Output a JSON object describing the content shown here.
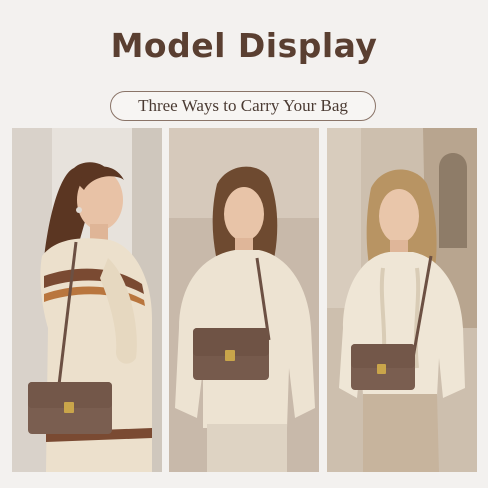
{
  "page": {
    "title": "Model Display",
    "subtitle": "Three Ways to Carry Your Bag"
  },
  "panels": [
    {
      "id": "model-1",
      "pose": "side view, bag on shoulder",
      "sweater": "striped cream knit",
      "bag_color": "#7a5e50"
    },
    {
      "id": "model-2",
      "pose": "front view, bag on shoulder",
      "sweater": "cream knit",
      "bag_color": "#765a4c"
    },
    {
      "id": "model-3",
      "pose": "front view, crossbody",
      "sweater": "cable knit",
      "bag_color": "#7a5e50"
    }
  ],
  "colors": {
    "background": "#f3f1ef",
    "title": "#5a3f31",
    "bag": "#7a5e50",
    "clasp": "#c9a54a"
  }
}
